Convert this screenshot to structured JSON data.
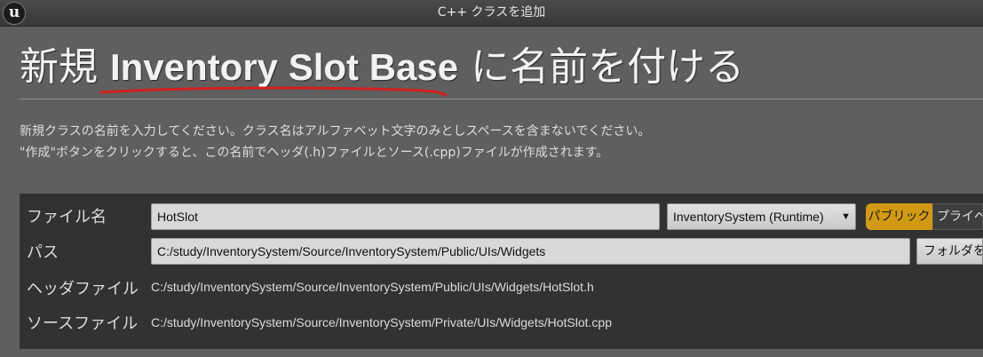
{
  "window": {
    "title": "C++ クラスを追加",
    "logo_text": "u"
  },
  "heading": {
    "prefix": "新規",
    "class_name": "Inventory Slot Base",
    "suffix": "に名前を付ける",
    "annotation_color": "#d21f1f"
  },
  "description": {
    "line1": "新規クラスの名前を入力してください。クラス名はアルファベット文字のみとしスペースを含まないでください。",
    "line2": "\"作成\"ボタンをクリックすると、この名前でヘッダ(.h)ファイルとソース(.cpp)ファイルが作成されます。"
  },
  "form": {
    "name": {
      "label": "ファイル名",
      "value": "HotSlot"
    },
    "module": {
      "selected": "InventorySystem (Runtime)",
      "icon": "chevron-down-icon"
    },
    "visibility": {
      "public_label": "パブリック",
      "private_label": "プライベート",
      "selected": "public",
      "accent": "#d29a14"
    },
    "path": {
      "label": "パス",
      "value": "C:/study/InventorySystem/Source/InventorySystem/Public/UIs/Widgets",
      "button_label": "フォルダを選択"
    },
    "header_file": {
      "label": "ヘッダファイル",
      "value": "C:/study/InventorySystem/Source/InventorySystem/Public/UIs/Widgets/HotSlot.h"
    },
    "source_file": {
      "label": "ソースファイル",
      "value": "C:/study/InventorySystem/Source/InventorySystem/Private/UIs/Widgets/HotSlot.cpp"
    }
  }
}
